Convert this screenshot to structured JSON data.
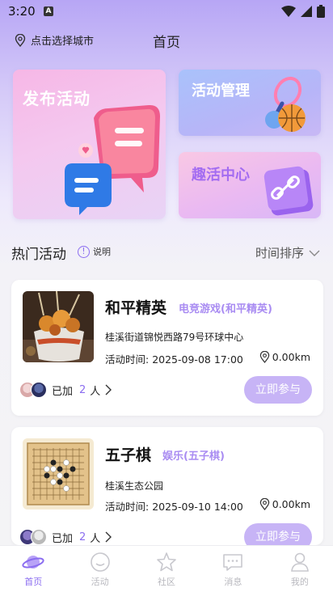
{
  "status": {
    "time": "3:20"
  },
  "header": {
    "location_label": "点击选择城市",
    "title": "首页"
  },
  "banners": {
    "publish": "发布活动",
    "manage": "活动管理",
    "fun_center": "趣活中心"
  },
  "section": {
    "title": "热门活动",
    "explain_label": "说明",
    "sort_label": "时间排序"
  },
  "activities": [
    {
      "name": "和平精英",
      "category": "电竞游戏(和平精英)",
      "address": "桂溪街道锦悦西路79号环球中心",
      "time_label": "活动时间:",
      "time": "2025-09-08 17:00",
      "distance": "0.00km",
      "joined_prefix": "已加",
      "joined_count": "2",
      "joined_suffix": "人",
      "join_button": "立即参与",
      "image_icon": "food-photo"
    },
    {
      "name": "五子棋",
      "category": "娱乐(五子棋)",
      "address": "桂溪生态公园",
      "time_label": "活动时间:",
      "time": "2025-09-10 14:00",
      "distance": "0.00km",
      "joined_prefix": "已加",
      "joined_count": "2",
      "joined_suffix": "人",
      "join_button": "立即参与",
      "image_icon": "gomoku-board"
    }
  ],
  "tabbar": [
    {
      "label": "首页",
      "icon": "planet-icon",
      "active": true
    },
    {
      "label": "活动",
      "icon": "smile-icon",
      "active": false
    },
    {
      "label": "社区",
      "icon": "star-icon",
      "active": false
    },
    {
      "label": "消息",
      "icon": "chat-icon",
      "active": false
    },
    {
      "label": "我的",
      "icon": "user-icon",
      "active": false
    }
  ],
  "colors": {
    "accent": "#8b6df0",
    "button": "#c7b4f6",
    "category": "#a98cf2"
  }
}
